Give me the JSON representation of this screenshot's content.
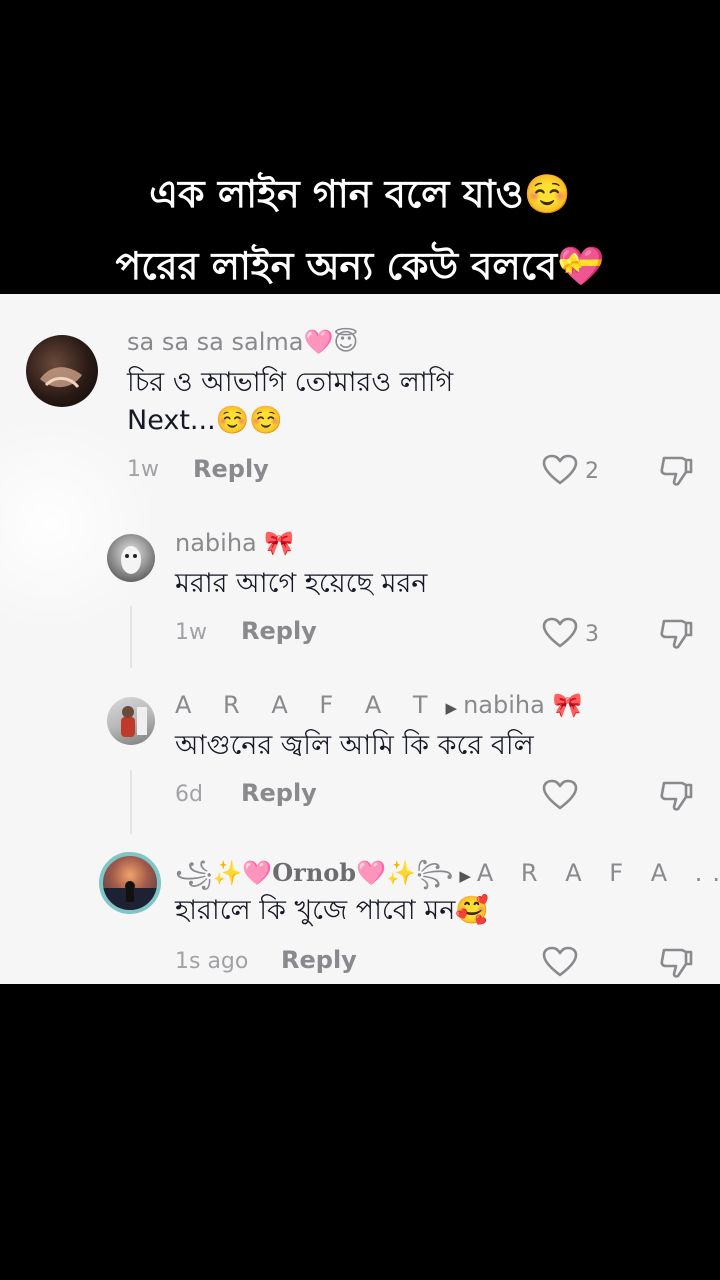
{
  "overlay": {
    "line1": "এক লাইন গান বলে যাও☺️",
    "line2": "পরের লাইন অন্য কেউ বলবে💝"
  },
  "comments": [
    {
      "username": "sa sa sa salma🩷😇",
      "text_line1": "চির ও আভাগি তোমারও লাগি",
      "text_line2": "Next...☺️☺️",
      "time": "1w",
      "reply_label": "Reply",
      "likes": "2"
    },
    {
      "username": "nabiha 🎀",
      "text": "মরার আগে হয়েছে মরন",
      "time": "1w",
      "reply_label": "Reply",
      "likes": "3"
    },
    {
      "username": "A R A F A T",
      "reply_to": "nabiha 🎀",
      "text": "আগুনের জ্বলি আমি কি করে বলি",
      "time": "6d",
      "reply_label": "Reply",
      "likes": ""
    },
    {
      "username_prefix": "꧁✨🩷",
      "username_main": "Ornob",
      "username_suffix": "🩷✨꧂",
      "reply_to": "A R A F A ...",
      "text": "হারালে কি খুজে পাবো মন🥰",
      "time": "1s ago",
      "reply_label": "Reply",
      "likes": ""
    }
  ],
  "icons": {
    "like": "heart-outline-icon",
    "dislike": "thumbs-down-icon",
    "reply_arrow": "triangle-right-icon"
  }
}
